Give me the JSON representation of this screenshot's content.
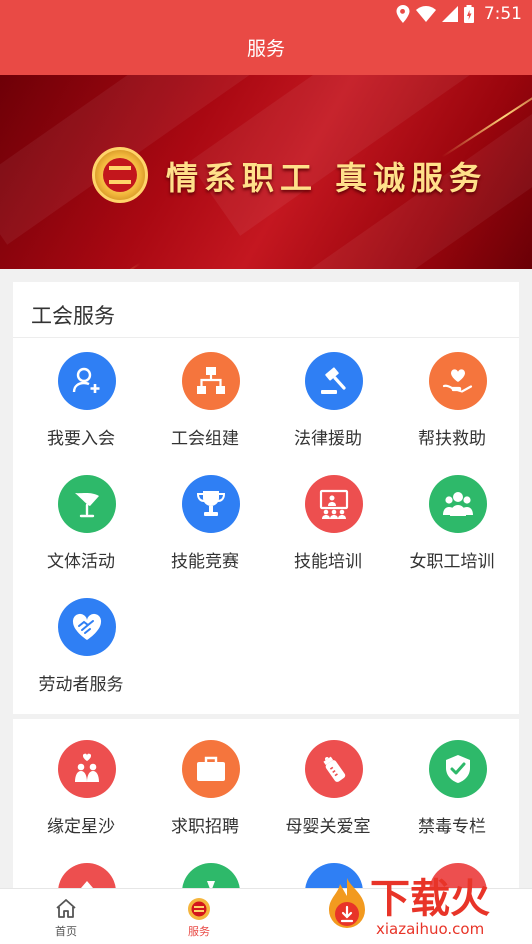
{
  "status_bar": {
    "time": "7:51"
  },
  "app_bar": {
    "title": "服务"
  },
  "banner": {
    "slogan": "情系职工 真诚服务"
  },
  "union_services": {
    "title": "工会服务",
    "items": [
      {
        "label": "我要入会",
        "icon": "user-add-icon",
        "color": "#2f7ff4"
      },
      {
        "label": "工会组建",
        "icon": "org-chart-icon",
        "color": "#f5753d"
      },
      {
        "label": "法律援助",
        "icon": "gavel-icon",
        "color": "#2f7ff4"
      },
      {
        "label": "帮扶救助",
        "icon": "heart-hand-icon",
        "color": "#f5753d"
      },
      {
        "label": "文体活动",
        "icon": "shuttlecock-icon",
        "color": "#2eb96a"
      },
      {
        "label": "技能竞赛",
        "icon": "trophy-icon",
        "color": "#2f7ff4"
      },
      {
        "label": "技能培训",
        "icon": "classroom-icon",
        "color": "#ed4f4f"
      },
      {
        "label": "女职工培训",
        "icon": "women-group-icon",
        "color": "#2eb96a"
      },
      {
        "label": "劳动者服务",
        "icon": "handshake-heart-icon",
        "color": "#2f7ff4"
      }
    ]
  },
  "other_services": {
    "items": [
      {
        "label": "缘定星沙",
        "icon": "couple-icon",
        "color": "#ed4f4f"
      },
      {
        "label": "求职招聘",
        "icon": "briefcase-icon",
        "color": "#f5753d"
      },
      {
        "label": "母婴关爱室",
        "icon": "baby-bottle-icon",
        "color": "#ed4f4f"
      },
      {
        "label": "禁毒专栏",
        "icon": "shield-check-icon",
        "color": "#2eb96a"
      }
    ],
    "partial_row_colors": [
      "#ed4f4f",
      "#2eb96a",
      "#2f7ff4",
      "#ed4f4f"
    ]
  },
  "tab_bar": {
    "tabs": [
      {
        "label": "首页",
        "icon": "home-icon",
        "active": false
      },
      {
        "label": "服务",
        "icon": "union-emblem-icon",
        "active": true
      }
    ],
    "active_color": "#e94a45",
    "inactive_color": "#555555"
  },
  "watermark": {
    "brand": "下载火",
    "site": "xiazaihuo.com"
  }
}
